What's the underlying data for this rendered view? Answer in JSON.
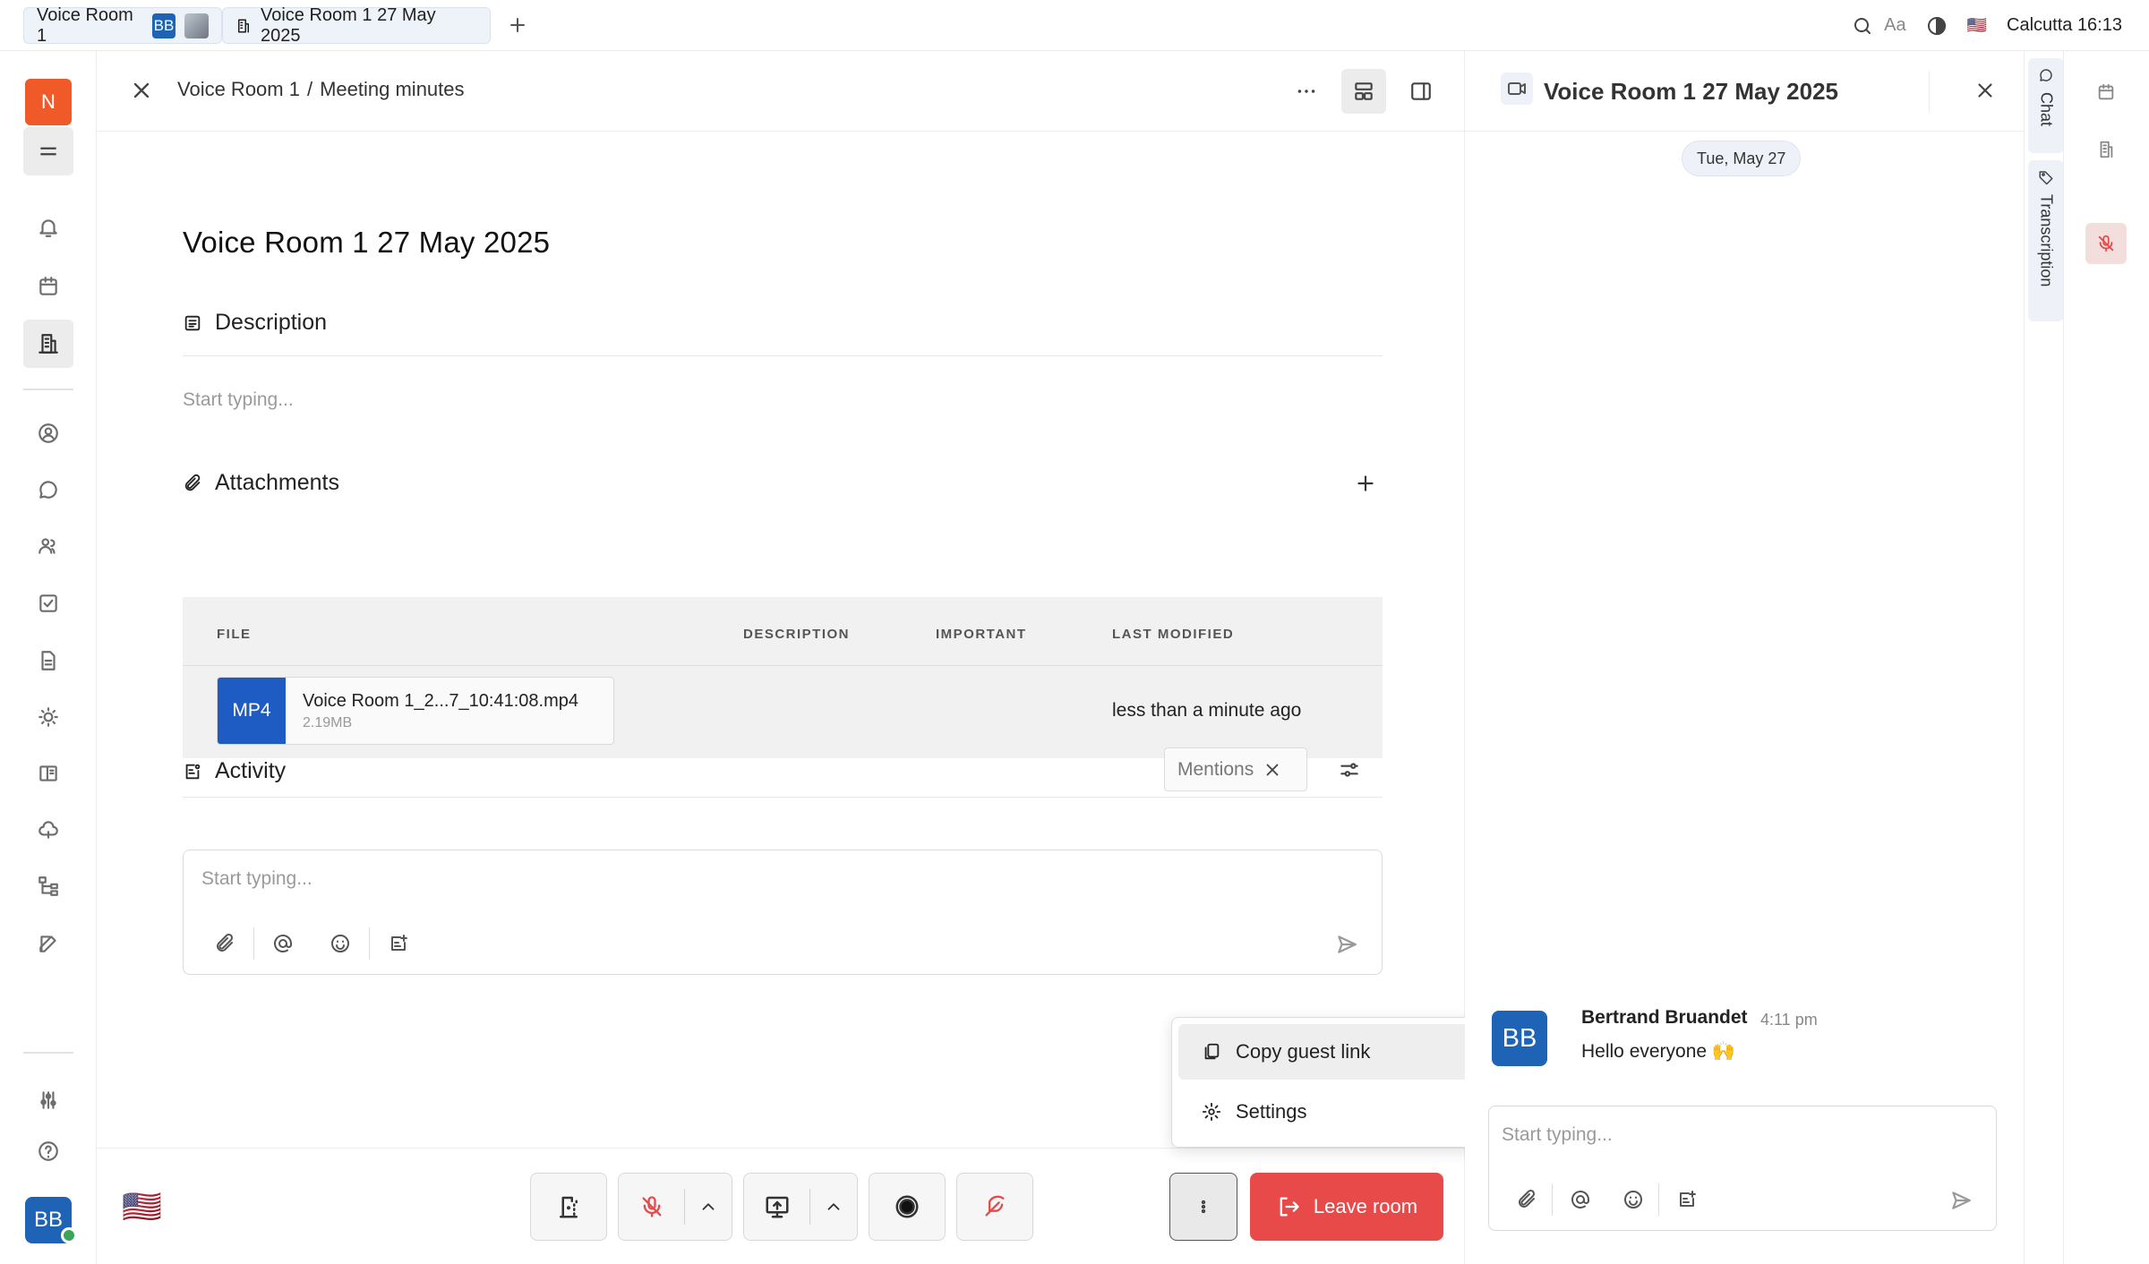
{
  "tabs": [
    {
      "label": "Voice Room 1",
      "avatar_initials": "BB"
    },
    {
      "label": "Voice Room 1 27 May 2025"
    }
  ],
  "top_right": {
    "font_label": "Aa",
    "location": "Calcutta",
    "time": "16:13"
  },
  "sidebar": {
    "workspace_initial": "N",
    "user_initials": "BB"
  },
  "header": {
    "room": "Voice Room 1",
    "separator": "/",
    "page": "Meeting minutes"
  },
  "doc": {
    "title": "Voice Room 1 27 May 2025",
    "description_heading": "Description",
    "description_placeholder": "Start typing...",
    "attachments_heading": "Attachments",
    "columns": {
      "file": "FILE",
      "description": "DESCRIPTION",
      "important": "IMPORTANT",
      "last_modified": "LAST MODIFIED"
    },
    "attachment": {
      "type": "MP4",
      "name": "Voice Room 1_2...7_10:41:08.mp4",
      "size": "2.19MB",
      "modified": "less than a minute ago"
    },
    "activity_heading": "Activity",
    "mentions_filter": "Mentions",
    "composer_placeholder": "Start typing..."
  },
  "menu": {
    "copy_link": "Copy guest link",
    "settings": "Settings"
  },
  "callbar": {
    "leave": "Leave room"
  },
  "chat": {
    "title": "Voice Room 1 27 May 2025",
    "date": "Tue, May 27",
    "message": {
      "initials": "BB",
      "author": "Bertrand Bruandet",
      "time": "4:11 pm",
      "text": "Hello everyone 🙌"
    },
    "composer_placeholder": "Start typing..."
  },
  "rail": {
    "chat": "Chat",
    "transcription": "Transcription"
  },
  "colors": {
    "accent": "#1e63b5",
    "danger": "#e84a4a",
    "workspace": "#f05a28"
  }
}
